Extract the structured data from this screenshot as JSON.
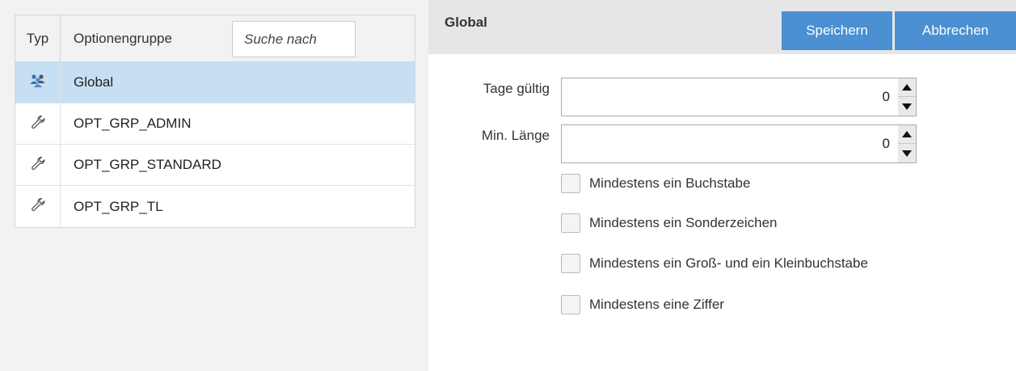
{
  "list": {
    "header_typ": "Typ",
    "header_group": "Optionengruppe",
    "search_placeholder": "Suche nach",
    "rows": [
      {
        "label": "Global",
        "icon": "users-group-icon",
        "selected": true
      },
      {
        "label": "OPT_GRP_ADMIN",
        "icon": "wrench-icon",
        "selected": false
      },
      {
        "label": "OPT_GRP_STANDARD",
        "icon": "wrench-icon",
        "selected": false
      },
      {
        "label": "OPT_GRP_TL",
        "icon": "wrench-icon",
        "selected": false
      }
    ]
  },
  "detail": {
    "title": "Global",
    "save_label": "Speichern",
    "cancel_label": "Abbrechen",
    "fields": {
      "tage_label": "Tage gültig",
      "tage_value": "0",
      "laenge_label": "Min. Länge",
      "laenge_value": "0"
    },
    "checkboxes": [
      {
        "label": "Mindestens ein Buchstabe",
        "checked": false
      },
      {
        "label": "Mindestens ein Sonderzeichen",
        "checked": false
      },
      {
        "label": "Mindestens ein Groß- und ein Kleinbuchstabe",
        "checked": false
      },
      {
        "label": "Mindestens eine Ziffer",
        "checked": false
      }
    ]
  },
  "colors": {
    "accent": "#4a90d2",
    "selected_row": "#c7dff2"
  }
}
